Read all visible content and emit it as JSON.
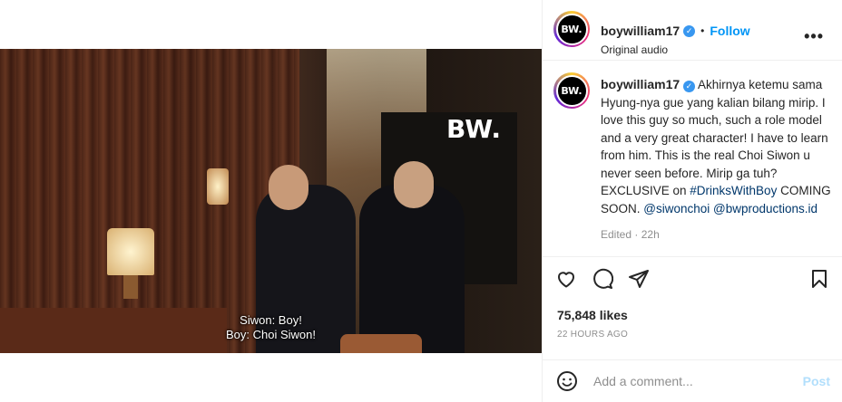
{
  "video": {
    "watermark": "BW.",
    "subtitles": [
      "Siwon: Boy!",
      "Boy: Choi Siwon!"
    ],
    "mute_icon": "speaker-muted-icon"
  },
  "header": {
    "avatar_text": "BW.",
    "username": "boywilliam17",
    "separator": "•",
    "follow_label": "Follow",
    "audio_label": "Original audio",
    "more_label": "•••"
  },
  "caption": {
    "avatar_text": "BW.",
    "username": "boywilliam17",
    "text_before_tag": "Akhirnya ketemu sama Hyung-nya gue yang kalian bilang mirip. I love this guy so much, such a role model and a very great character! I have to learn from him. This is the real Choi Siwon u never seen before. Mirip ga tuh? EXCLUSIVE on ",
    "hashtag": "#DrinksWithBoy",
    "text_after_tag": " COMING SOON.",
    "mention1": "@siwonchoi",
    "mention2": "@bwproductions.id",
    "edited": "Edited",
    "meta_separator": "·",
    "age": "22h"
  },
  "post": {
    "likes": "75,848 likes",
    "timestamp": "22 HOURS AGO"
  },
  "comment": {
    "placeholder": "Add a comment...",
    "post_label": "Post"
  },
  "colors": {
    "link": "#00376b",
    "follow": "#0095f6",
    "post_disabled": "#b2dffc",
    "verified": "#3897f0"
  }
}
